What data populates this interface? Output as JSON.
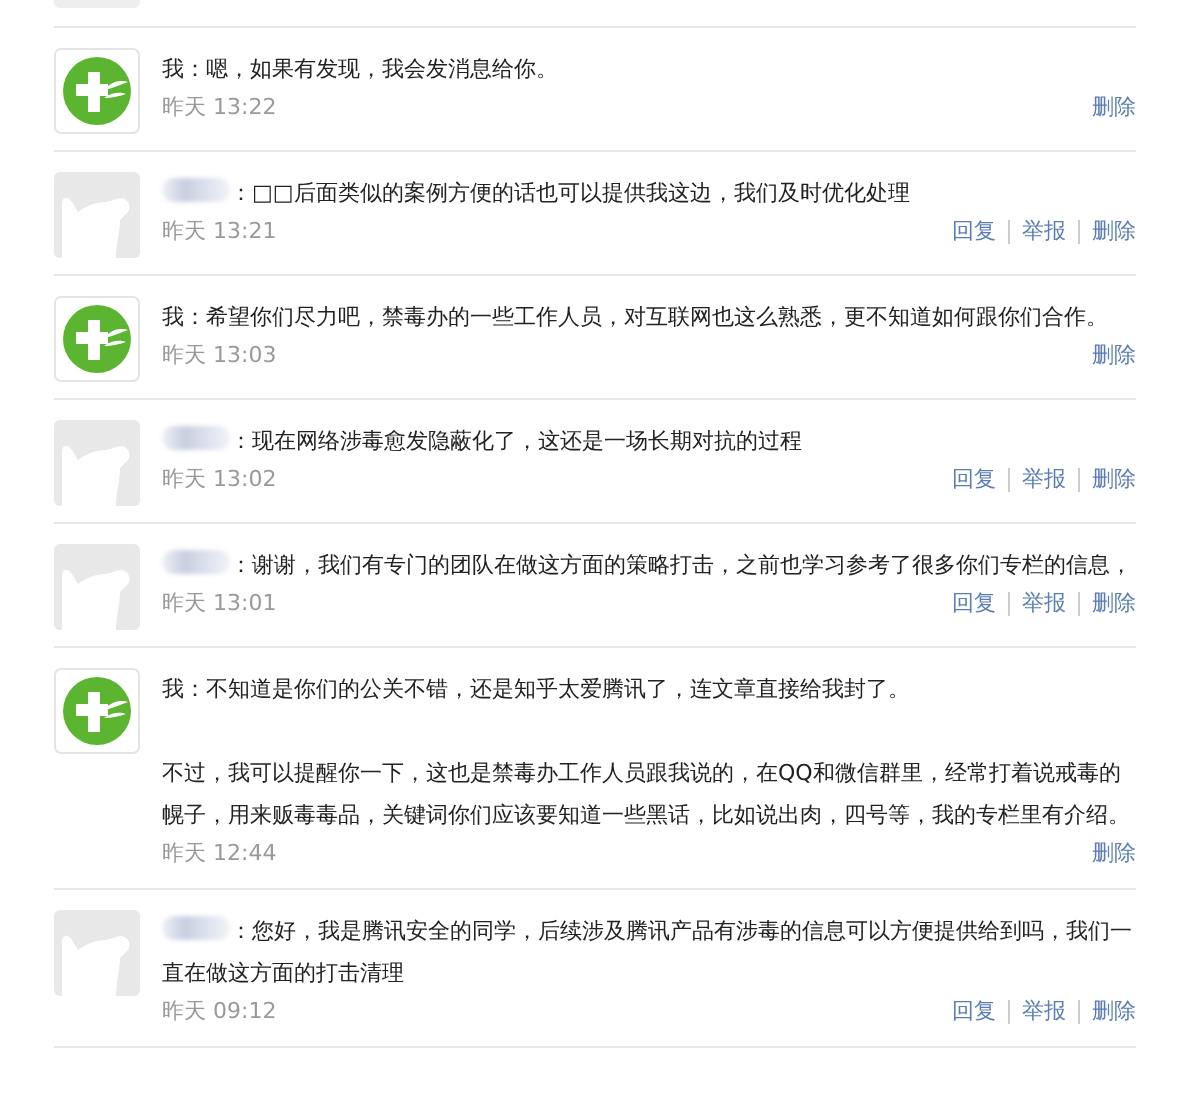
{
  "messages": [
    {
      "kind": "self",
      "sender": "我",
      "text": "：嗯，如果有发现，我会发消息给你。",
      "time": "昨天 13:22",
      "actions": [
        "删除"
      ]
    },
    {
      "kind": "other",
      "text": "：□□后面类似的案例方便的话也可以提供我这边，我们及时优化处理",
      "time": "昨天 13:21",
      "actions": [
        "回复",
        "举报",
        "删除"
      ]
    },
    {
      "kind": "self",
      "sender": "我",
      "text": "：希望你们尽力吧，禁毒办的一些工作人员，对互联网也这么熟悉，更不知道如何跟你们合作。",
      "time": "昨天 13:03",
      "actions": [
        "删除"
      ]
    },
    {
      "kind": "other",
      "text": "：现在网络涉毒愈发隐蔽化了，这还是一场长期对抗的过程",
      "time": "昨天 13:02",
      "actions": [
        "回复",
        "举报",
        "删除"
      ]
    },
    {
      "kind": "other",
      "text": "：谢谢，我们有专门的团队在做这方面的策略打击，之前也学习参考了很多你们专栏的信息，",
      "time": "昨天 13:01",
      "actions": [
        "回复",
        "举报",
        "删除"
      ]
    },
    {
      "kind": "self",
      "sender": "我",
      "text": "：不知道是你们的公关不错，还是知乎太爱腾讯了，连文章直接给我封了。",
      "more": [
        "不过，我可以提醒你一下，这也是禁毒办工作人员跟我说的，在QQ和微信群里，经常打着说戒毒的幌子，用来贩毒毒品，关键词你们应该要知道一些黑话，比如说出肉，四号等，我的专栏里有介绍。"
      ],
      "time": "昨天 12:44",
      "actions": [
        "删除"
      ]
    },
    {
      "kind": "other",
      "text": "：您好，我是腾讯安全的同学，后续涉及腾讯产品有涉毒的信息可以方便提供给到吗，我们一直在做这方面的打击清理",
      "time": "昨天 09:12",
      "actions": [
        "回复",
        "举报",
        "删除"
      ]
    }
  ]
}
